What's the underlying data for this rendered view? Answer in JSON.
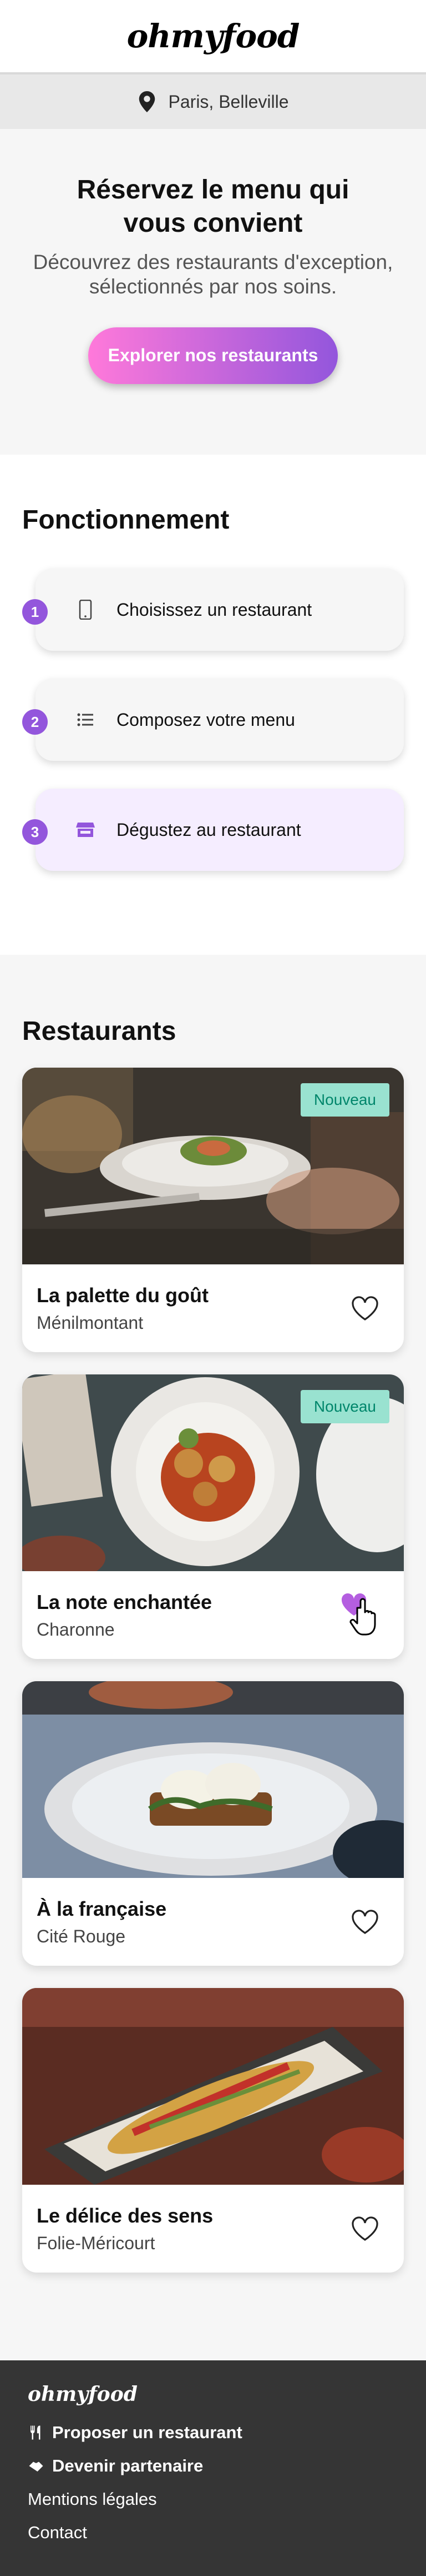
{
  "header": {
    "logo": "ohmyfood"
  },
  "location": {
    "icon": "map-pin-icon",
    "text": "Paris, Belleville"
  },
  "hero": {
    "title": "Réservez le menu qui vous convient",
    "subtitle": "Découvrez des restaurants d'exception, sélectionnés par nos soins.",
    "cta": "Explorer nos restaurants"
  },
  "how": {
    "title": "Fonctionnement",
    "steps": [
      {
        "num": "1",
        "icon": "mobile-phone-icon",
        "label": "Choisissez un restaurant"
      },
      {
        "num": "2",
        "icon": "list-icon",
        "label": "Composez votre menu"
      },
      {
        "num": "3",
        "icon": "store-icon",
        "label": "Dégustez au restaurant"
      }
    ]
  },
  "restaurants": {
    "title": "Restaurants",
    "items": [
      {
        "name": "La palette du goût",
        "area": "Ménilmontant",
        "badge": "Nouveau",
        "liked": false
      },
      {
        "name": "La note enchantée",
        "area": "Charonne",
        "badge": "Nouveau",
        "liked": true
      },
      {
        "name": "À la française",
        "area": "Cité Rouge",
        "badge": "",
        "liked": false
      },
      {
        "name": "Le délice des sens",
        "area": "Folie-Méricourt",
        "badge": "",
        "liked": false
      }
    ]
  },
  "footer": {
    "logo": "ohmyfood",
    "links": [
      {
        "icon": "utensils-icon",
        "label": "Proposer un restaurant"
      },
      {
        "icon": "handshake-icon",
        "label": "Devenir partenaire"
      },
      {
        "icon": "",
        "label": "Mentions légales"
      },
      {
        "icon": "",
        "label": "Contact"
      }
    ]
  },
  "colors": {
    "accent": "#9356dc",
    "gradient_start": "#ff79da",
    "badge_bg": "#99e2d0",
    "badge_text": "#00866b",
    "footer_bg": "#353535"
  }
}
